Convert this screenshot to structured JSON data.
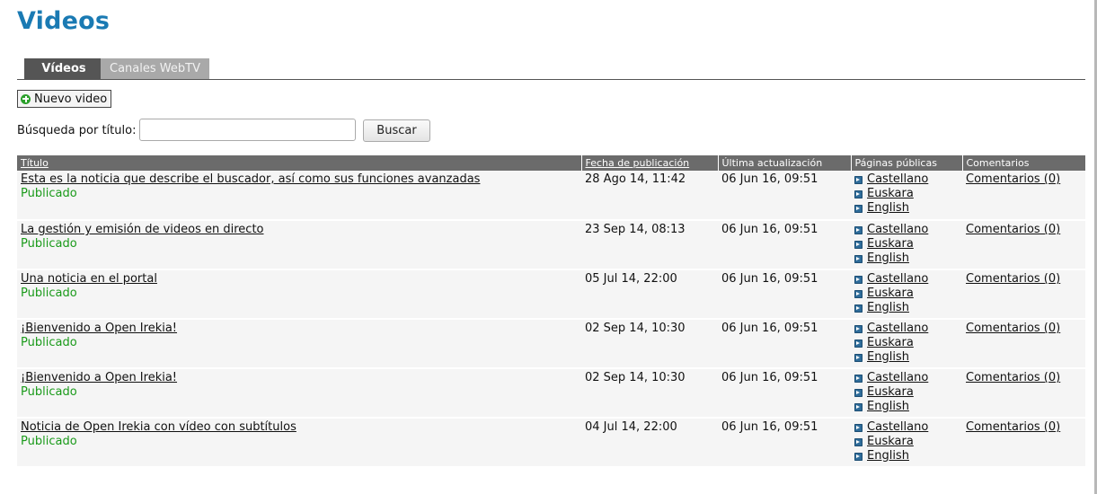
{
  "page": {
    "title": "Videos"
  },
  "tabs": [
    {
      "label": "Vídeos",
      "active": true
    },
    {
      "label": "Canales WebTV",
      "active": false
    }
  ],
  "toolbar": {
    "new_video_label": "Nuevo video"
  },
  "search": {
    "label": "Búsqueda por título:",
    "value": "",
    "placeholder": "",
    "button_label": "Buscar"
  },
  "table": {
    "headers": {
      "title": "Título",
      "published": "Fecha de publicación",
      "updated": "Última actualización",
      "pages": "Páginas públicas",
      "comments": "Comentarios"
    },
    "rows": [
      {
        "title": "Esta es la noticia que describe el buscador, así como sus funciones avanzadas",
        "status": "Publicado",
        "published": "28 Ago 14, 11:42",
        "updated": "06 Jun 16, 09:51",
        "langs": [
          "Castellano",
          "Euskara",
          "English"
        ],
        "comments": "Comentarios (0)"
      },
      {
        "title": "La gestión y emisión de videos en directo",
        "status": "Publicado",
        "published": "23 Sep 14, 08:13",
        "updated": "06 Jun 16, 09:51",
        "langs": [
          "Castellano",
          "Euskara",
          "English"
        ],
        "comments": "Comentarios (0)"
      },
      {
        "title": "Una noticia en el portal",
        "status": "Publicado",
        "published": "05 Jul 14, 22:00",
        "updated": "06 Jun 16, 09:51",
        "langs": [
          "Castellano",
          "Euskara",
          "English"
        ],
        "comments": "Comentarios (0)"
      },
      {
        "title": "¡Bienvenido a Open Irekia!",
        "status": "Publicado",
        "published": "02 Sep 14, 10:30",
        "updated": "06 Jun 16, 09:51",
        "langs": [
          "Castellano",
          "Euskara",
          "English"
        ],
        "comments": "Comentarios (0)"
      },
      {
        "title": "¡Bienvenido a Open Irekia!",
        "status": "Publicado",
        "published": "02 Sep 14, 10:30",
        "updated": "06 Jun 16, 09:51",
        "langs": [
          "Castellano",
          "Euskara",
          "English"
        ],
        "comments": "Comentarios (0)"
      },
      {
        "title": "Noticia de Open Irekia con vídeo con subtítulos",
        "status": "Publicado",
        "published": "04 Jul 14, 22:00",
        "updated": "06 Jun 16, 09:51",
        "langs": [
          "Castellano",
          "Euskara",
          "English"
        ],
        "comments": "Comentarios (0)"
      }
    ]
  },
  "icons": {
    "new_video": "plus-circle-icon",
    "language_link": "arrow-right-icon"
  },
  "colors": {
    "title": "#1a7ab3",
    "status": "#1a9a1a",
    "header_bg": "#6b6b6b",
    "plus": "#2ba02b"
  }
}
